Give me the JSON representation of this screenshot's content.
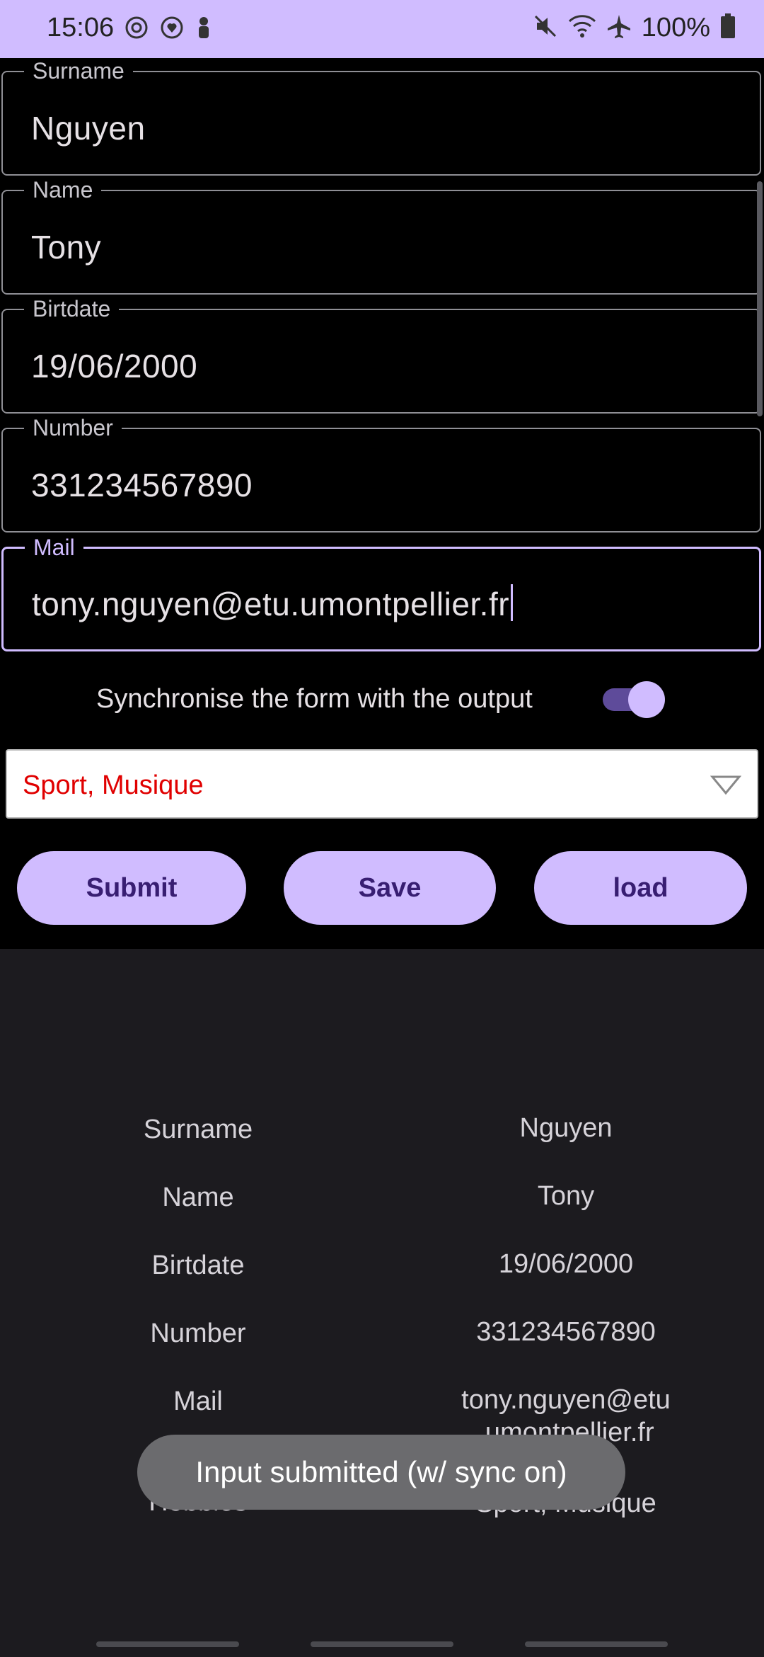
{
  "status_bar": {
    "time": "15:06",
    "battery": "100%",
    "left_icons": [
      "sync-icon",
      "heart-sync-icon",
      "notification-person-icon"
    ],
    "right_icons": [
      "mute-icon",
      "wifi-icon",
      "airplane-icon",
      "battery-icon"
    ]
  },
  "form": {
    "fields": [
      {
        "label": "Surname",
        "value": "Nguyen"
      },
      {
        "label": "Name",
        "value": "Tony"
      },
      {
        "label": "Birtdate",
        "value": "19/06/2000"
      },
      {
        "label": "Number",
        "value": "331234567890"
      },
      {
        "label": "Mail",
        "value": "tony.nguyen@etu.umontpellier.fr"
      }
    ],
    "sync_label": "Synchronise the form with the output",
    "sync_on": true,
    "hobbies_selected": "Sport, Musique",
    "buttons": {
      "submit": "Submit",
      "save": "Save",
      "load": "load"
    }
  },
  "output": {
    "rows": [
      {
        "label": "Surname",
        "value": "Nguyen"
      },
      {
        "label": "Name",
        "value": "Tony"
      },
      {
        "label": "Birtdate",
        "value": "19/06/2000"
      },
      {
        "label": "Number",
        "value": "331234567890"
      },
      {
        "label": "Mail",
        "value_line1": "tony.nguyen@etu",
        "value_line2": ".umontpellier.fr"
      },
      {
        "label": "Hobbies",
        "value": "Sport, Musique"
      }
    ]
  },
  "toast": "Input submitted (w/ sync on)",
  "colors": {
    "accent": "#d0bcff",
    "error_text": "#e00000",
    "panel_bg": "#1c1b1f"
  }
}
